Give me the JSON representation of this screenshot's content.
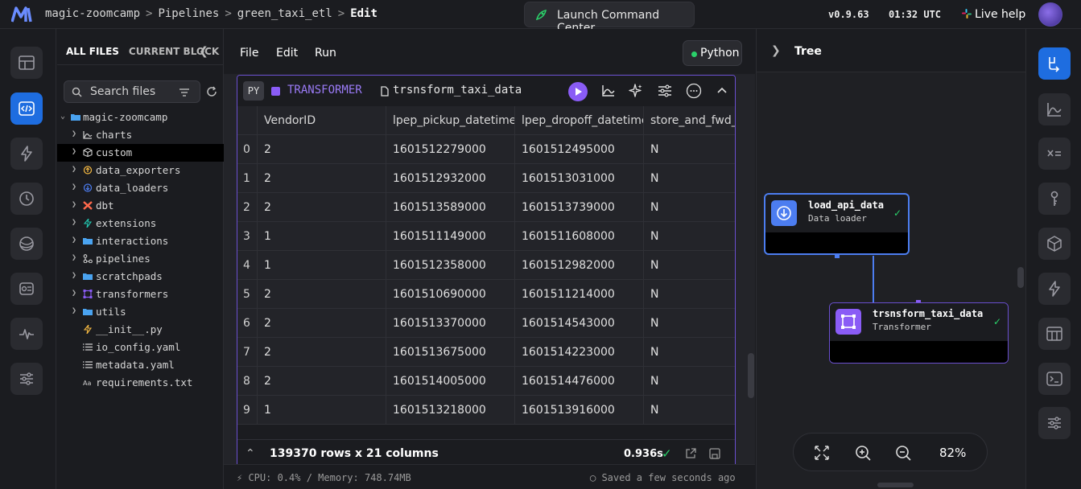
{
  "header": {
    "breadcrumbs": [
      "magic-zoomcamp",
      "Pipelines",
      "green_taxi_etl",
      "Edit"
    ],
    "command_center": "Launch Command Center",
    "version": "v0.9.63",
    "time": "01:32 UTC",
    "live_help": "Live help"
  },
  "left_rail": {
    "items": [
      "pipelines-overview",
      "edit-pipeline",
      "triggers",
      "runs",
      "dbt",
      "block-monitor",
      "pipeline-monitor",
      "settings"
    ],
    "active": "edit-pipeline"
  },
  "files": {
    "tabs": [
      "ALL FILES",
      "CURRENT BLOCK"
    ],
    "search_placeholder": "Search files",
    "root": "magic-zoomcamp",
    "items": [
      {
        "name": "charts",
        "type": "folder",
        "icon": "chart-icon",
        "color": "#cfcfcf"
      },
      {
        "name": "custom",
        "type": "folder",
        "icon": "cube-icon",
        "color": "#cfcfcf"
      },
      {
        "name": "data_exporters",
        "type": "folder",
        "icon": "exporter-icon",
        "color": "#f5b942"
      },
      {
        "name": "data_loaders",
        "type": "folder",
        "icon": "loader-icon",
        "color": "#4c7df0"
      },
      {
        "name": "dbt",
        "type": "folder",
        "icon": "dbt-icon",
        "color": "#ff694b"
      },
      {
        "name": "extensions",
        "type": "folder",
        "icon": "bolt-icon",
        "color": "#22c7b0"
      },
      {
        "name": "interactions",
        "type": "folder",
        "icon": "folder-icon",
        "color": "#4aa3f0"
      },
      {
        "name": "pipelines",
        "type": "folder",
        "icon": "pipeline-icon",
        "color": "#cfcfcf"
      },
      {
        "name": "scratchpads",
        "type": "folder",
        "icon": "folder-icon",
        "color": "#4aa3f0"
      },
      {
        "name": "transformers",
        "type": "folder",
        "icon": "transformer-icon",
        "color": "#8a5cf6"
      },
      {
        "name": "utils",
        "type": "folder",
        "icon": "folder-icon",
        "color": "#4aa3f0"
      },
      {
        "name": "__init__.py",
        "type": "file",
        "icon": "python-icon",
        "color": "#f5b942"
      },
      {
        "name": "io_config.yaml",
        "type": "file",
        "icon": "list-icon",
        "color": "#cfcfcf"
      },
      {
        "name": "metadata.yaml",
        "type": "file",
        "icon": "list-icon",
        "color": "#cfcfcf"
      },
      {
        "name": "requirements.txt",
        "type": "file",
        "icon": "text-icon",
        "color": "#cfcfcf"
      }
    ],
    "selected": "custom"
  },
  "editor": {
    "menu": [
      "File",
      "Edit",
      "Run"
    ],
    "kernel": "Python",
    "block": {
      "lang": "PY",
      "type": "TRANSFORMER",
      "name": "trsnsform_taxi_data"
    },
    "table": {
      "columns": [
        "VendorID",
        "lpep_pickup_datetime",
        "lpep_dropoff_datetime",
        "store_and_fwd_f"
      ],
      "rows": [
        [
          "0",
          "2",
          "1601512279000",
          "1601512495000",
          "N"
        ],
        [
          "1",
          "2",
          "1601512932000",
          "1601513031000",
          "N"
        ],
        [
          "2",
          "2",
          "1601513589000",
          "1601513739000",
          "N"
        ],
        [
          "3",
          "1",
          "1601511149000",
          "1601511608000",
          "N"
        ],
        [
          "4",
          "1",
          "1601512358000",
          "1601512982000",
          "N"
        ],
        [
          "5",
          "2",
          "1601510690000",
          "1601511214000",
          "N"
        ],
        [
          "6",
          "2",
          "1601513370000",
          "1601514543000",
          "N"
        ],
        [
          "7",
          "2",
          "1601513675000",
          "1601514223000",
          "N"
        ],
        [
          "8",
          "2",
          "1601514005000",
          "1601514476000",
          "N"
        ],
        [
          "9",
          "1",
          "1601513218000",
          "1601513916000",
          "N"
        ]
      ]
    },
    "footer": {
      "rows_summary": "139370 rows x 21 columns",
      "exec_time": "0.936s"
    }
  },
  "status_bar": {
    "resources": "CPU: 0.4%  /  Memory: 748.74MB",
    "saved": "Saved a few seconds ago"
  },
  "tree_panel": {
    "title": "Tree",
    "nodes": [
      {
        "name": "load_api_data",
        "kind": "Data loader",
        "lang": "PY",
        "color": "#4c7df0"
      },
      {
        "name": "trsnsform_taxi_data",
        "kind": "Transformer",
        "lang": "PY",
        "color": "#8a5cf6"
      }
    ],
    "zoom": "82%"
  },
  "right_rail": {
    "items": [
      "tree",
      "charts",
      "variables",
      "secrets",
      "blocks",
      "triggers",
      "table",
      "terminal",
      "settings"
    ],
    "active": "tree"
  },
  "colors": {
    "accent": "#1e6de0",
    "transformer": "#8a5cf6",
    "loader": "#4c7df0",
    "success": "#2ad16a"
  }
}
